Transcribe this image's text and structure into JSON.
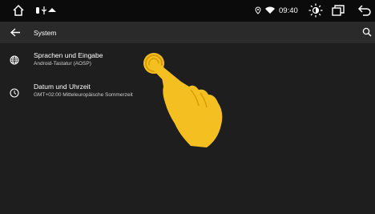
{
  "status_bar": {
    "time": "09:40",
    "icons": [
      "home-icon",
      "notification-dot-icon",
      "usb-icon",
      "cloud-icon",
      "location-icon",
      "wifi-icon",
      "brightness-icon",
      "recent-apps-icon",
      "back-icon"
    ]
  },
  "app_bar": {
    "title": "System",
    "icons": [
      "back-arrow-icon",
      "search-icon"
    ]
  },
  "settings": {
    "items": [
      {
        "icon": "globe-icon",
        "title": "Sprachen und Eingabe",
        "subtitle": "Android-Tastatur (AOSP)"
      },
      {
        "icon": "clock-icon",
        "title": "Datum und Uhrzeit",
        "subtitle": "GMT+02:00 Mitteleuropäische Sommerzeit"
      }
    ]
  },
  "overlay": {
    "icon": "tap-hand-icon",
    "color": "#f4c021"
  },
  "colors": {
    "status_bar": "#0b0b0b",
    "app_bar": "#2a2a2a",
    "background": "#1e1e1e"
  }
}
